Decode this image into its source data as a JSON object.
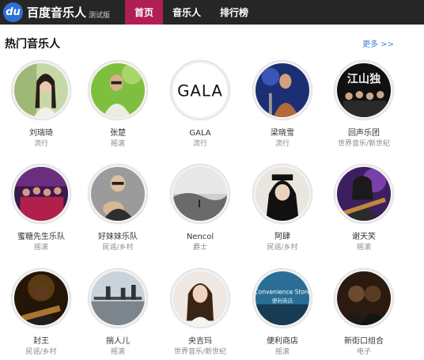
{
  "app": {
    "logo_badge": "du",
    "logo_name": "百度音乐人",
    "logo_beta": "测试版"
  },
  "nav": [
    "首页",
    "音乐人",
    "排行榜"
  ],
  "section": {
    "title": "热门音乐人",
    "more": "更多 >>"
  },
  "artists": [
    {
      "name": "刘瑞琦",
      "genre": "流行"
    },
    {
      "name": "张楚",
      "genre": "摇滚"
    },
    {
      "name": "GALA",
      "genre": "流行",
      "logo_text": "GALA"
    },
    {
      "name": "梁晓雪",
      "genre": "流行"
    },
    {
      "name": "回声乐团",
      "genre": "世界音乐/新世纪",
      "logo_text": "江山独"
    },
    {
      "name": "蜜糖先生乐队",
      "genre": "摇滚"
    },
    {
      "name": "好妹妹乐队",
      "genre": "民谣/乡村"
    },
    {
      "name": "Nencol",
      "genre": "爵士"
    },
    {
      "name": "阿肆",
      "genre": "民谣/乡村"
    },
    {
      "name": "谢天笑",
      "genre": "摇滚"
    },
    {
      "name": "封王",
      "genre": "民谣/乡村"
    },
    {
      "name": "揣人儿",
      "genre": "摇滚"
    },
    {
      "name": "央吉玛",
      "genre": "世界音乐/新世纪"
    },
    {
      "name": "便利商店",
      "genre": "摇滚",
      "logo_text": "Convenience Store",
      "logo_sub": "便利商店"
    },
    {
      "name": "新街口组合",
      "genre": "电子"
    }
  ],
  "colors": {
    "topbar": "#262626",
    "nav_active": "#b01f54",
    "link": "#3d7fd0"
  }
}
